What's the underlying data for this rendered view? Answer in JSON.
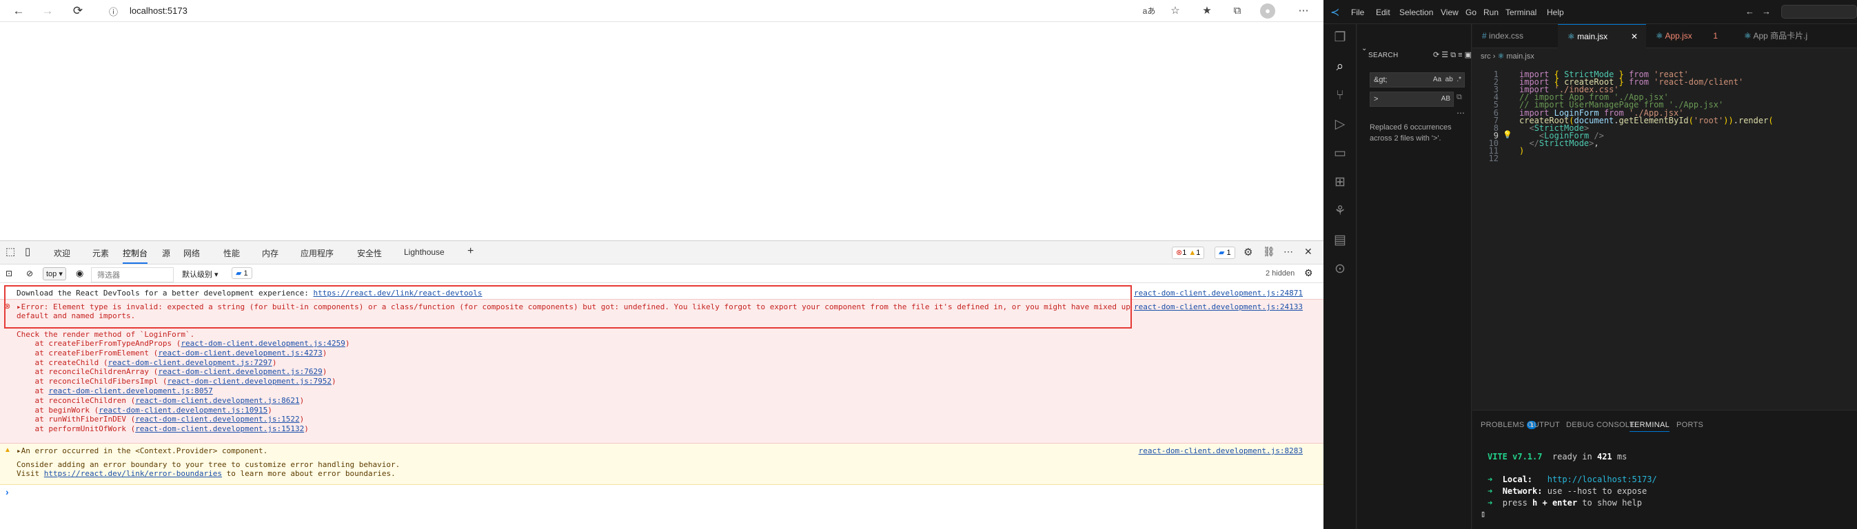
{
  "browser": {
    "nav": {
      "back": "←",
      "forward": "→",
      "reload": "⟳"
    },
    "url": "localhost:5173",
    "info_icon": "ⓘ"
  },
  "devtools": {
    "tabs": [
      "欢迎",
      "元素",
      "控制台",
      "源",
      "网络",
      "性能",
      "内存",
      "应用程序",
      "安全性",
      "Lighthouse"
    ],
    "active_tab": "控制台",
    "badges": {
      "errors": "1",
      "warnings": "1",
      "messages": "1"
    },
    "toolbar": {
      "context": "top",
      "filter_placeholder": "筛选器",
      "levels": "默认级别",
      "issues": "1",
      "hidden": "2 hidden"
    },
    "console": {
      "info_line": "Download the React DevTools for a better development experience: ",
      "info_link": "https://react.dev/link/react-devtools",
      "info_src": "react-dom-client.development.js:24871",
      "error_line1": "Error: Element type is invalid: expected a string (for built-in components) or a class/function (for composite components) but got: undefined. You likely forgot to export your component from the file it's defined in, or you might have mixed up",
      "error_line2": "default and named imports.",
      "error_src": "react-dom-client.development.js:24133",
      "check": "Check the render method of `LoginForm`.",
      "stack": [
        {
          "fn": "    at createFiberFromTypeAndProps (",
          "link": "react-dom-client.development.js:4259",
          "end": ")"
        },
        {
          "fn": "    at createFiberFromElement (",
          "link": "react-dom-client.development.js:4273",
          "end": ")"
        },
        {
          "fn": "    at createChild (",
          "link": "react-dom-client.development.js:7297",
          "end": ")"
        },
        {
          "fn": "    at reconcileChildrenArray (",
          "link": "react-dom-client.development.js:7629",
          "end": ")"
        },
        {
          "fn": "    at reconcileChildFibersImpl (",
          "link": "react-dom-client.development.js:7952",
          "end": ")"
        },
        {
          "fn": "    at ",
          "link": "react-dom-client.development.js:8057",
          "end": ""
        },
        {
          "fn": "    at reconcileChildren (",
          "link": "react-dom-client.development.js:8621",
          "end": ")"
        },
        {
          "fn": "    at beginWork (",
          "link": "react-dom-client.development.js:10915",
          "end": ")"
        },
        {
          "fn": "    at runWithFiberInDEV (",
          "link": "react-dom-client.development.js:1522",
          "end": ")"
        },
        {
          "fn": "    at performUnitOfWork (",
          "link": "react-dom-client.development.js:15132",
          "end": ")"
        }
      ],
      "warn_line": "An error occurred in the <Context.Provider> component.",
      "warn_src": "react-dom-client.development.js:8283",
      "warn_line2": "Consider adding an error boundary to your tree to customize error handling behavior.",
      "warn_line3a": "Visit ",
      "warn_link": "https://react.dev/link/error-boundaries",
      "warn_line3b": " to learn more about error boundaries.",
      "prompt": "›"
    }
  },
  "vscode": {
    "menu": [
      "File",
      "Edit",
      "Selection",
      "View",
      "Go",
      "Run",
      "Terminal",
      "Help"
    ],
    "search": {
      "title": "SEARCH",
      "find": "&gt;",
      "replace": ">",
      "case": "Aa",
      "word": "ab",
      "regex": ".*",
      "preserve": "AB",
      "result": "Replaced 6 occurrences across 2 files with '>'."
    },
    "tabs": [
      {
        "label": "index.css",
        "icon": "#",
        "color": "#9d9d9d"
      },
      {
        "label": "main.jsx",
        "icon": "⚛",
        "color": "#ffffff"
      },
      {
        "label": "App.jsx",
        "icon": "⚛",
        "color": "#f48771",
        "badge": "1"
      },
      {
        "label": "App 商品卡片.j",
        "icon": "⚛",
        "color": "#9d9d9d"
      }
    ],
    "breadcrumb": {
      "folder": "src",
      "file": "main.jsx"
    },
    "code_lines": [
      "1",
      "2",
      "3",
      "4",
      "5",
      "6",
      "7",
      "8",
      "9",
      "10",
      "11",
      "12"
    ],
    "panel": {
      "tabs": [
        "PROBLEMS",
        "OUTPUT",
        "DEBUG CONSOLE",
        "TERMINAL",
        "PORTS"
      ],
      "problems_count": "1",
      "active": "TERMINAL"
    },
    "terminal": {
      "vite": "VITE v7.1.7",
      "ready": "  ready in ",
      "ms": "421",
      "ms_unit": " ms",
      "local_label": "Local:",
      "local_url": "http://localhost:5173/",
      "network_label": "Network:",
      "network_text": " use --host to expose",
      "help_a": "press ",
      "help_b": "h + enter",
      "help_c": " to show help"
    }
  }
}
